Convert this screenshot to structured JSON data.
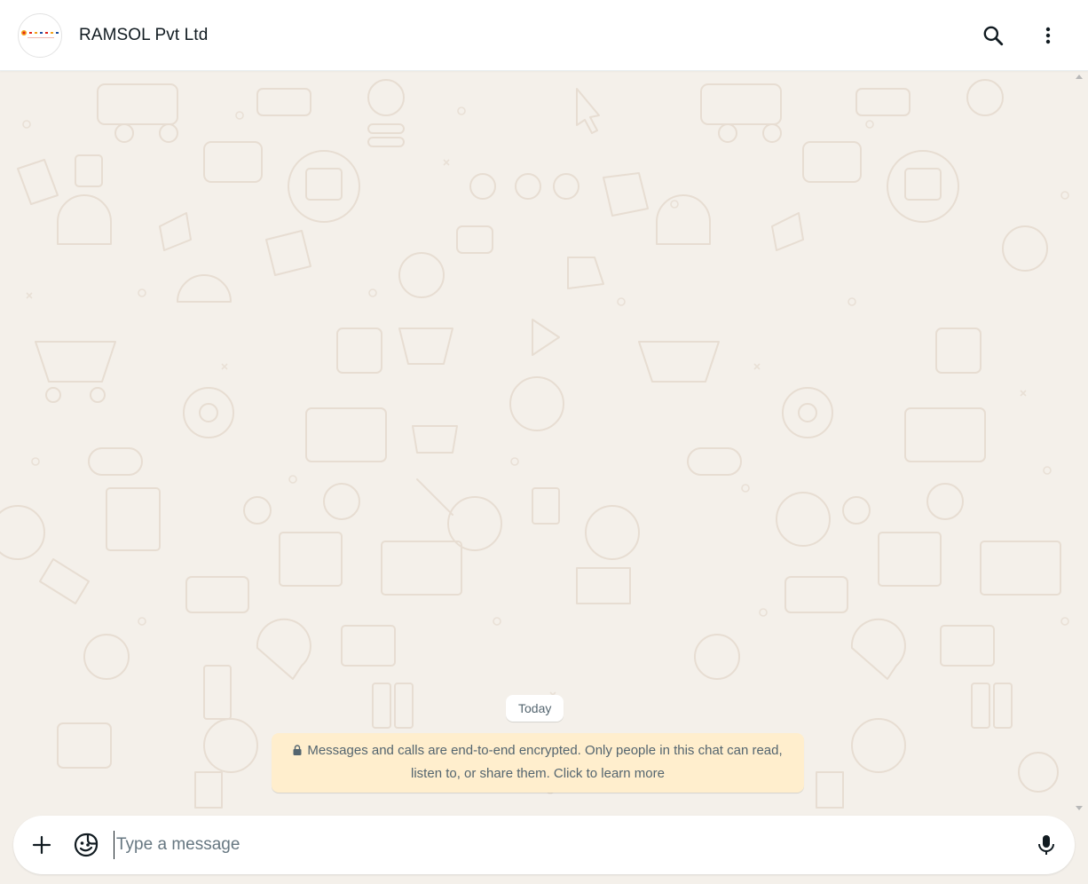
{
  "header": {
    "contact_name": "RAMSOL Pvt Ltd",
    "avatar_icon": "ramsol-logo",
    "search_icon": "search-icon",
    "menu_icon": "more-vertical-icon"
  },
  "chat": {
    "wallpaper": "doodle-pattern",
    "date_chip": "Today",
    "encryption_notice": {
      "line1": "Messages and calls are end-to-end encrypted. Only people in this chat can read,",
      "line2": "listen to, or share them. Click to learn more",
      "icon": "lock-icon"
    }
  },
  "composer": {
    "attach_icon": "plus-icon",
    "sticker_icon": "sticker-icon",
    "placeholder": "Type a message",
    "value": "",
    "mic_icon": "microphone-icon"
  },
  "colors": {
    "header_bg": "#ffffff",
    "chat_bg": "#f4f0ea",
    "notice_bg": "#ffeecd",
    "text_primary": "#111b21",
    "text_secondary": "#54656f"
  }
}
